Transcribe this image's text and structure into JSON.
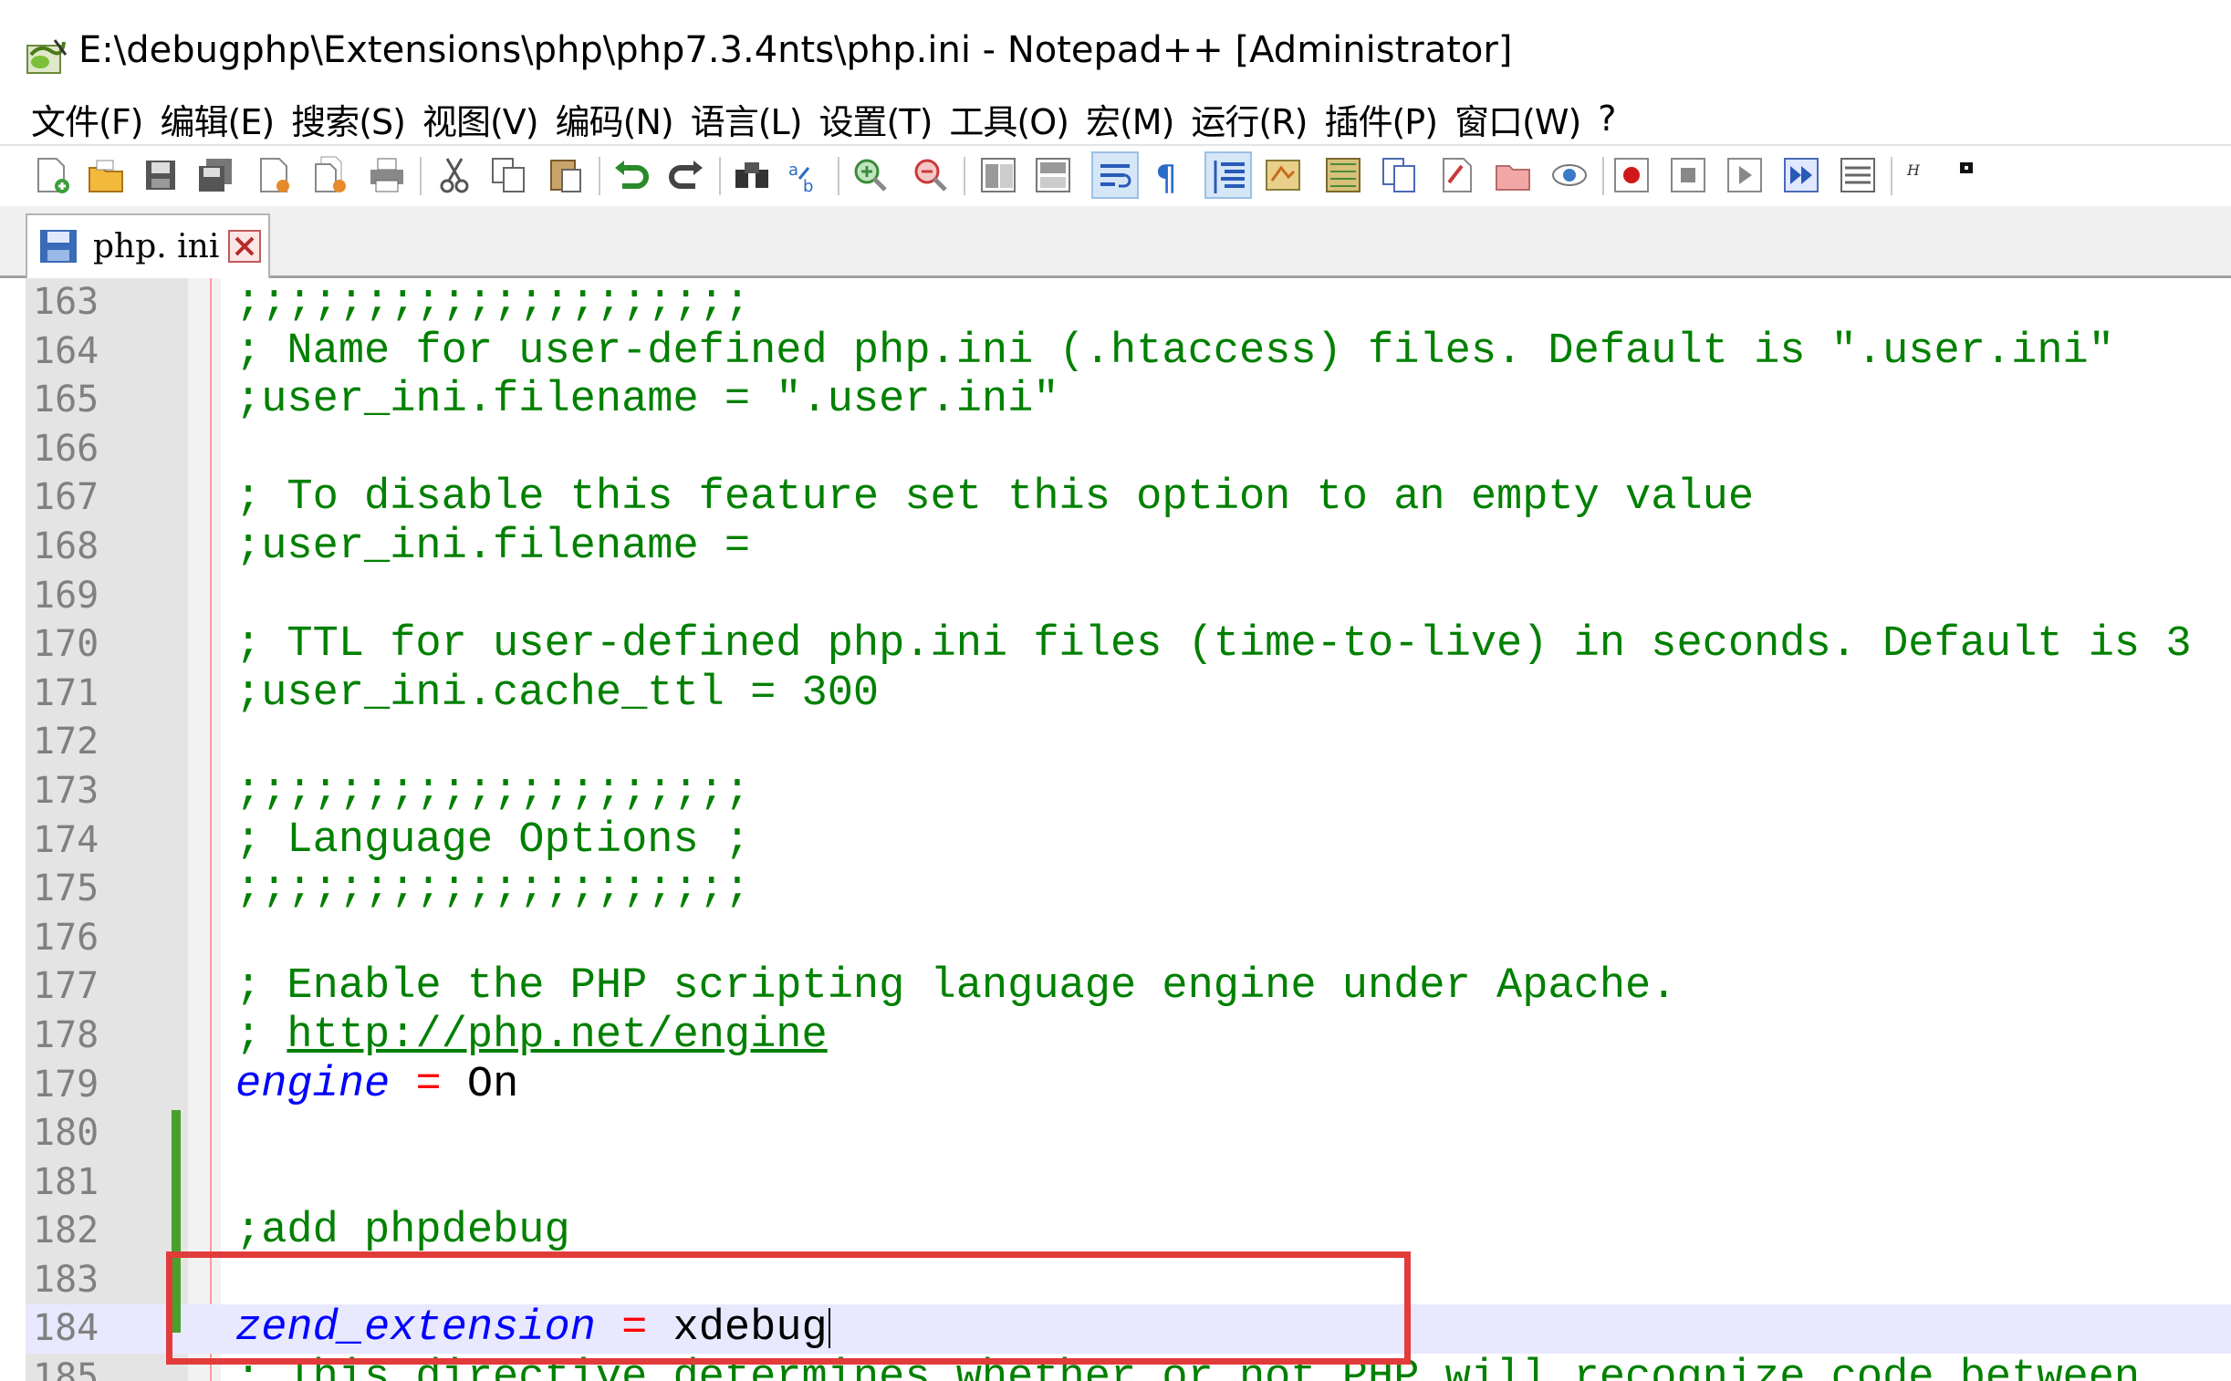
{
  "window": {
    "title": "E:\\debugphp\\Extensions\\php\\php7.3.4nts\\php.ini - Notepad++ [Administrator]"
  },
  "menu": [
    "文件(F)",
    "编辑(E)",
    "搜索(S)",
    "视图(V)",
    "编码(N)",
    "语言(L)",
    "设置(T)",
    "工具(O)",
    "宏(M)",
    "运行(R)",
    "插件(P)",
    "窗口(W)",
    "?"
  ],
  "toolbar": {
    "buttons": [
      "new-file-icon",
      "open-file-icon",
      "save-icon",
      "save-all-icon",
      "close-icon",
      "close-all-icon",
      "print-icon",
      "cut-icon",
      "copy-icon",
      "paste-icon",
      "undo-icon",
      "redo-icon",
      "find-icon",
      "replace-icon",
      "zoom-in-icon",
      "zoom-out-icon",
      "sync-vertical-icon",
      "sync-horizontal-icon",
      "word-wrap-icon",
      "show-all-chars-icon",
      "indent-guide-icon",
      "user-lang-icon",
      "doc-map-icon",
      "function-list-icon",
      "folder-workspace-icon",
      "monitoring-icon",
      "record-macro-icon",
      "stop-macro-icon",
      "play-macro-icon",
      "run-macro-multiple-icon",
      "save-macro-icon"
    ]
  },
  "tab": {
    "label": "php. ini"
  },
  "editor": {
    "lines": [
      {
        "n": "163",
        "parts": [
          {
            "t": ";;;;;;;;;;;;;;;;;;;;",
            "c": "comment"
          }
        ]
      },
      {
        "n": "164",
        "parts": [
          {
            "t": "; Name for user-defined php.ini (.htaccess) files. Default is \".user.ini\"",
            "c": "comment"
          }
        ]
      },
      {
        "n": "165",
        "parts": [
          {
            "t": ";user_ini.filename = \".user.ini\"",
            "c": "comment"
          }
        ]
      },
      {
        "n": "166",
        "parts": []
      },
      {
        "n": "167",
        "parts": [
          {
            "t": "; To disable this feature set this option to an empty value",
            "c": "comment"
          }
        ]
      },
      {
        "n": "168",
        "parts": [
          {
            "t": ";user_ini.filename =",
            "c": "comment"
          }
        ]
      },
      {
        "n": "169",
        "parts": []
      },
      {
        "n": "170",
        "parts": [
          {
            "t": "; TTL for user-defined php.ini files (time-to-live) in seconds. Default is 3",
            "c": "comment"
          }
        ]
      },
      {
        "n": "171",
        "parts": [
          {
            "t": ";user_ini.cache_ttl = 300",
            "c": "comment"
          }
        ]
      },
      {
        "n": "172",
        "parts": []
      },
      {
        "n": "173",
        "parts": [
          {
            "t": ";;;;;;;;;;;;;;;;;;;;",
            "c": "comment"
          }
        ]
      },
      {
        "n": "174",
        "parts": [
          {
            "t": "; Language Options ;",
            "c": "comment"
          }
        ]
      },
      {
        "n": "175",
        "parts": [
          {
            "t": ";;;;;;;;;;;;;;;;;;;;",
            "c": "comment"
          }
        ]
      },
      {
        "n": "176",
        "parts": []
      },
      {
        "n": "177",
        "parts": [
          {
            "t": "; Enable the PHP scripting language engine under Apache.",
            "c": "comment"
          }
        ]
      },
      {
        "n": "178",
        "parts": [
          {
            "t": "; ",
            "c": "comment"
          },
          {
            "t": "http://php.net/engine",
            "c": "link"
          }
        ]
      },
      {
        "n": "179",
        "parts": [
          {
            "t": "engine",
            "c": "key"
          },
          {
            "t": " ",
            "c": "val"
          },
          {
            "t": "=",
            "c": "op"
          },
          {
            "t": " On",
            "c": "val"
          }
        ]
      },
      {
        "n": "180",
        "parts": []
      },
      {
        "n": "181",
        "parts": []
      },
      {
        "n": "182",
        "parts": [
          {
            "t": ";add phpdebug",
            "c": "comment"
          }
        ]
      },
      {
        "n": "183",
        "parts": []
      },
      {
        "n": "184",
        "parts": [
          {
            "t": "zend_extension",
            "c": "key"
          },
          {
            "t": " ",
            "c": "val"
          },
          {
            "t": "=",
            "c": "op"
          },
          {
            "t": " xdebug",
            "c": "val"
          }
        ],
        "current": true
      },
      {
        "n": "185",
        "parts": [
          {
            "t": "; This directive determines whether or not PHP will recognize code between",
            "c": "comment"
          }
        ]
      }
    ]
  },
  "colors": {
    "comment": "#008000",
    "keyword": "#0000ff",
    "operator": "#ff0000",
    "highlight_box": "#e23b3b",
    "current_line": "#e8e8ff",
    "change_bar": "#4aa02c"
  }
}
